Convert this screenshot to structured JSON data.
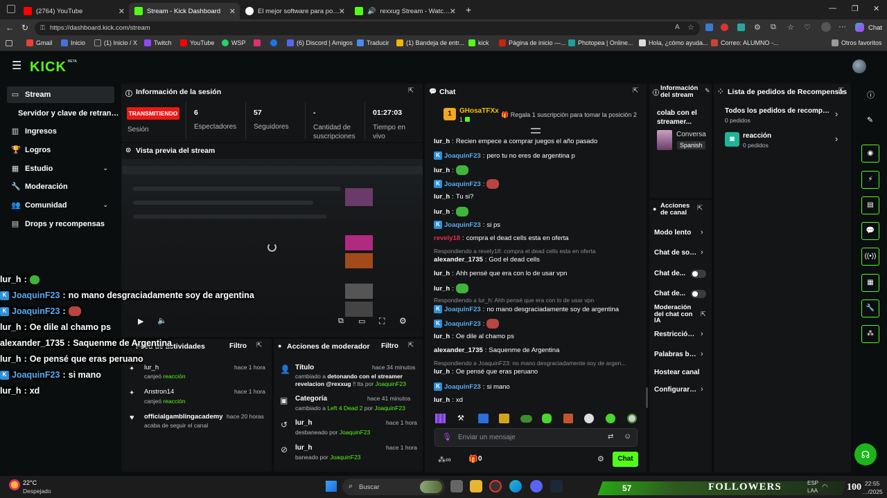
{
  "browser": {
    "tabs": [
      {
        "title": "(2764) YouTube",
        "color": "#ff0000"
      },
      {
        "title": "Stream - Kick Dashboard",
        "color": "#53fc18"
      },
      {
        "title": "El mejor software para potenciar tu",
        "color": "#ffffff"
      },
      {
        "title": "rexxug Stream - Watch Live o",
        "color": "#53fc18"
      }
    ],
    "url": "https://dashboard.kick.com/stream",
    "profile_label": "Chat",
    "bookmarks": [
      "Gmail",
      "Inicio",
      "(1) Inicio / X",
      "Twitch",
      "YouTube",
      "WSP",
      "(6) Discord | Amigos",
      "Traducir",
      "(1) Bandeja de entr...",
      "kick",
      "Página de inicio —...",
      "Photopea | Online...",
      "Hola, ¿cómo ayuda...",
      "Correo: ALUMNO -..."
    ],
    "bookmarks_other": "Otros favoritos"
  },
  "kick": {
    "logo": "KICK",
    "logo_badge": "BETA",
    "sidebar": [
      {
        "label": "Stream",
        "icon": "stream-icon"
      },
      {
        "label": "Servidor y clave de retransmisión",
        "icon": ""
      },
      {
        "label": "Ingresos",
        "icon": "chart-icon"
      },
      {
        "label": "Logros",
        "icon": "trophy-icon"
      },
      {
        "label": "Estudio",
        "icon": "studio-icon"
      },
      {
        "label": "Moderación",
        "icon": "wrench-icon"
      },
      {
        "label": "Comunidad",
        "icon": "community-icon"
      },
      {
        "label": "Drops y recompensas",
        "icon": "drops-icon"
      }
    ],
    "session": {
      "title": "Información de la sesión",
      "status": "TRANSMITIENDO",
      "status_label": "Sesión",
      "stats": [
        {
          "value": "6",
          "label": "Espectadores"
        },
        {
          "value": "57",
          "label": "Seguidores"
        },
        {
          "value": "-",
          "label": "Cantidad de suscripciones"
        },
        {
          "value": "01:27:03",
          "label": "Tiempo en vivo"
        }
      ]
    },
    "preview": {
      "title": "Vista previa del stream"
    },
    "activity": {
      "title": "Feed de actividades",
      "filter": "Filtro",
      "items": [
        {
          "user": "lur_h",
          "text": "canjeó ",
          "reward": "reacción",
          "time": "hace 1 hora"
        },
        {
          "user": "Anstron14",
          "text": "canjeó ",
          "reward": "reacción",
          "time": "hace 1 hora"
        },
        {
          "user": "officialgamblingacademy",
          "text": "acaba de seguir el canal",
          "reward": "",
          "time": "hace 20 horas"
        }
      ]
    },
    "modactions": {
      "title": "Acciones de moderador",
      "filter": "Filtro",
      "items": [
        {
          "title": "Título",
          "time": "hace 34 minutos",
          "line1": "cambiado a ",
          "val1": "detonando con el streamer revelacion @rexxug",
          "line2": " ‼ tts por ",
          "by": "JoaquinF23"
        },
        {
          "title": "Categoría",
          "time": "hace 41 minutos",
          "line1": "cambiado a ",
          "val1": "Left 4 Dead 2",
          "line2": " por ",
          "by": "JoaquinF23"
        },
        {
          "title": "lur_h",
          "time": "hace 1 hora",
          "line1": "desbaneado por ",
          "val1": "",
          "line2": "",
          "by": "JoaquinF23"
        },
        {
          "title": "lur_h",
          "time": "hace 1 hora",
          "line1": "baneado por ",
          "val1": "",
          "line2": "",
          "by": "JoaquinF23"
        }
      ]
    },
    "chat": {
      "title": "Chat",
      "top_user": "GHosaTFXx",
      "top_rank": "1",
      "top_count": "1",
      "promo": "Regala 1 suscripción para tomar la posición 2",
      "messages": [
        {
          "user": "lur_h",
          "text": "Recien empece a comprar juegos el año pasado",
          "kind": "plain"
        },
        {
          "user": "JoaquinF23",
          "text": "pero tu no eres de argentina p",
          "kind": "kick"
        },
        {
          "user": "lur_h",
          "text": "",
          "kind": "plain",
          "emote": true
        },
        {
          "user": "JoaquinF23",
          "text": "",
          "kind": "kick",
          "emote": true
        },
        {
          "user": "lur_h",
          "text": "Tu si?",
          "kind": "plain"
        },
        {
          "user": "lur_h",
          "text": "",
          "kind": "plain",
          "emote": true
        },
        {
          "user": "JoaquinF23",
          "text": "si ps",
          "kind": "kick"
        },
        {
          "user": "revely18",
          "text": "compra el dead cells esta en oferta",
          "kind": "red"
        },
        {
          "reply": "Respondiendo a revely18: compra el dead cells esta en oferta"
        },
        {
          "user": "alexander_1735",
          "text": "God el dead cells",
          "kind": "plain"
        },
        {
          "user": "lur_h",
          "text": "Ahh pensé que era con lo de usar vpn",
          "kind": "plain"
        },
        {
          "user": "lur_h",
          "text": "",
          "kind": "plain",
          "emote": true
        },
        {
          "reply": "Respondiendo a lur_h: Ahh pensé que era con lo de usar vpn"
        },
        {
          "user": "JoaquinF23",
          "text": "no mano desgraciadamente soy de argentina",
          "kind": "kick"
        },
        {
          "user": "JoaquinF23",
          "text": "",
          "kind": "kick",
          "emote": true
        },
        {
          "user": "lur_h",
          "text": "Oe dile al chamo ps",
          "kind": "plain"
        },
        {
          "user": "alexander_1735",
          "text": "Saquenme de Argentina",
          "kind": "plain"
        },
        {
          "reply": "Respondiendo a JoaquinF23: no mano desgraciadamente soy de argen..."
        },
        {
          "user": "lur_h",
          "text": "Oe pensé que eras peruano",
          "kind": "plain"
        },
        {
          "user": "JoaquinF23",
          "text": "si mano",
          "kind": "kick"
        },
        {
          "user": "lur_h",
          "text": "xd",
          "kind": "plain"
        }
      ],
      "input_placeholder": "Enviar un mensaje",
      "points": "0",
      "send": "Chat"
    },
    "streaminfo": {
      "title": "Información del stream",
      "stream_title": "colab con el streamer...",
      "category": "Conversa",
      "lang": "Spanish"
    },
    "channel_actions": {
      "title": "Acciones de canal",
      "items": [
        {
          "label": "Modo lento",
          "type": "arrow"
        },
        {
          "label": "Chat de solo-",
          "type": "arrow"
        },
        {
          "label": "Chat de...",
          "type": "toggle"
        },
        {
          "label": "Chat de...",
          "type": "toggle"
        },
        {
          "label": "Moderación del chat con IA",
          "type": "ext"
        },
        {
          "label": "Restricción d",
          "type": "arrow"
        },
        {
          "label": "Palabras bane",
          "type": "arrow"
        },
        {
          "label": "Hostear canal",
          "type": "none"
        },
        {
          "label": "Configurar ...",
          "type": "arrow"
        }
      ]
    },
    "rewards": {
      "title": "Lista de pedidos de Recompensas",
      "all": "Todos los pedidos de recompen...",
      "all_count": "0 pedidos",
      "item": "reacción",
      "item_count": "0 pedidos"
    }
  },
  "overlay_chat": [
    {
      "user": "lur_h",
      "text": "",
      "emote": true,
      "kick": false
    },
    {
      "user": "JoaquinF23",
      "text": "no mano desgraciadamente soy de argentina",
      "emote": false,
      "kick": true
    },
    {
      "user": "JoaquinF23",
      "text": "",
      "emote": true,
      "kick": true
    },
    {
      "user": "lur_h",
      "text": "Oe dile al chamo ps",
      "emote": false,
      "kick": false
    },
    {
      "user": "alexander_1735",
      "text": "Saquenme de Argentina",
      "emote": false,
      "kick": false
    },
    {
      "user": "lur_h",
      "text": "Oe pensé que eras peruano",
      "emote": false,
      "kick": false
    },
    {
      "user": "JoaquinF23",
      "text": "si mano",
      "emote": false,
      "kick": true
    },
    {
      "user": "lur_h",
      "text": "xd",
      "emote": false,
      "kick": false
    }
  ],
  "taskbar": {
    "weather_temp": "22°C",
    "weather_desc": "Despejado",
    "search": "Buscar",
    "followers_count": "57",
    "followers_label": "FOLLOWERS",
    "followers_goal": "100",
    "lang": "ESP",
    "lang2": "LAA",
    "time": "22:55",
    "date": "…/2025"
  },
  "colors": {
    "accent": "#53fc18",
    "live": "#e91916",
    "kick_blue": "#2f8fd8"
  }
}
